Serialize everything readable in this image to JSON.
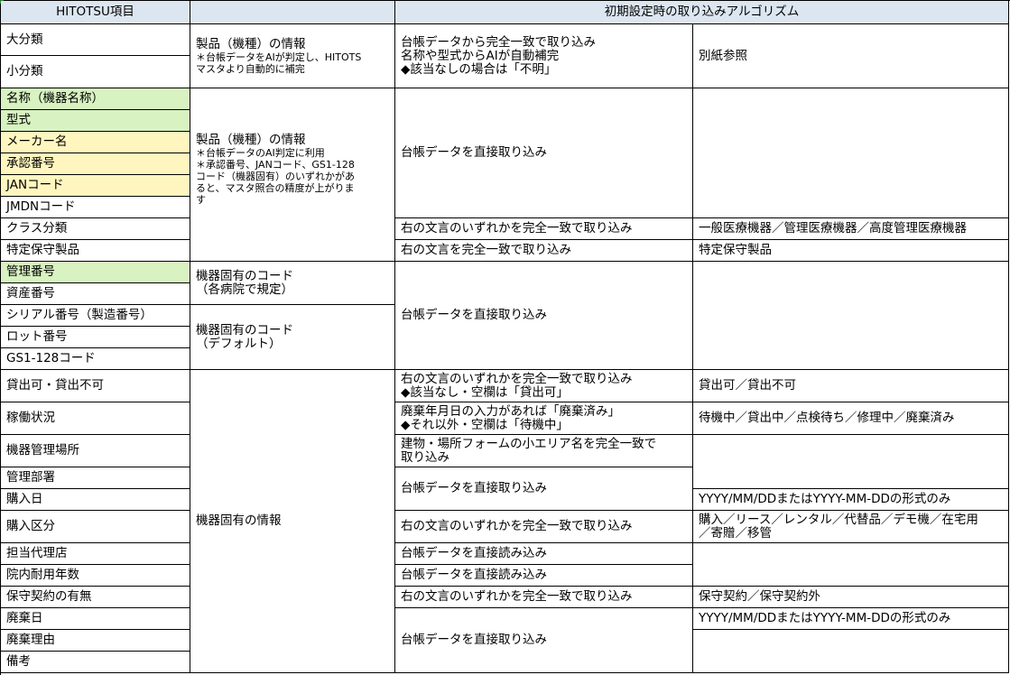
{
  "header": {
    "col1": "HITOTSU項目",
    "col2": "",
    "col3": "初期設定時の取り込みアルゴリズム"
  },
  "items": [
    "大分類",
    "小分類",
    "名称（機器名称）",
    "型式",
    "メーカー名",
    "承認番号",
    "JANコード",
    "JMDNコード",
    "クラス分類",
    "特定保守製品",
    "管理番号",
    "資産番号",
    "シリアル番号（製造番号）",
    "ロット番号",
    "GS1-128コード",
    "貸出可・貸出不可",
    "稼働状況",
    "機器管理場所",
    "管理部署",
    "購入日",
    "購入区分",
    "担当代理店",
    "院内耐用年数",
    "保守契約の有無",
    "廃棄日",
    "廃棄理由",
    "備考"
  ],
  "descriptions": {
    "d1_title": "製品（機種）の情報",
    "d1_note1": "＊台帳データをAIが判定し、HITOTS",
    "d1_note2": "マスタより自動的に補完",
    "d2_title": "製品（機種）の情報",
    "d2_note1": "＊台帳データのAI判定に利用",
    "d2_note2": "＊承認番号、JANコード、GS1-128",
    "d2_note3": "コード（機器固有）のいずれかがあ",
    "d2_note4": "ると、マスタ照合の精度が上がりま",
    "d2_note5": "す",
    "d3_line1": "機器固有のコード",
    "d3_line2": "（各病院で規定）",
    "d4_line1": "機器固有のコード",
    "d4_line2": "（デフォルト）",
    "d5": "機器固有の情報"
  },
  "algorithms": {
    "a1_line1": "台帳データから完全一致で取り込み",
    "a1_line2": "名称や型式からAIが自動補完",
    "a1_line3": "◆該当なしの場合は「不明」",
    "a2": "台帳データを直接取り込み",
    "a3": "右の文言のいずれかを完全一致で取り込み",
    "a4": "右の文言を完全一致で取り込み",
    "a5": "台帳データを直接取り込み",
    "a6_line1": "右の文言のいずれかを完全一致で取り込み",
    "a6_line2": "◆該当なし・空欄は「貸出可」",
    "a7_line1": "廃棄年月日の入力があれば「廃棄済み」",
    "a7_line2": "◆それ以外・空欄は「待機中」",
    "a8_line1": "建物・場所フォームの小エリア名を完全一致で",
    "a8_line2": "取り込み",
    "a9": "台帳データを直接取り込み",
    "a10": "右の文言のいずれかを完全一致で取り込み",
    "a11": "台帳データを直接読み込み",
    "a12": "台帳データを直接読み込み",
    "a13": "右の文言のいずれかを完全一致で取り込み",
    "a14": "台帳データを直接取り込み"
  },
  "options": {
    "o1": "別紙参照",
    "o2": "一般医療機器／管理医療機器／高度管理医療機器",
    "o3": "特定保守製品",
    "o4": "貸出可／貸出不可",
    "o5": "待機中／貸出中／点検待ち／修理中／廃棄済み",
    "o6": "YYYY/MM/DDまたはYYYY-MM-DDの形式のみ",
    "o7_line1": "購入／リース／レンタル／代替品／デモ機／在宅用",
    "o7_line2": "／寄贈／移管",
    "o8": "保守契約／保守契約外",
    "o9": "YYYY/MM/DDまたはYYYY-MM-DDの形式のみ"
  },
  "colors": {
    "header_bg": "#dce6f1",
    "green_highlight": "#d8f2c1",
    "yellow_highlight": "#fff6bf"
  }
}
